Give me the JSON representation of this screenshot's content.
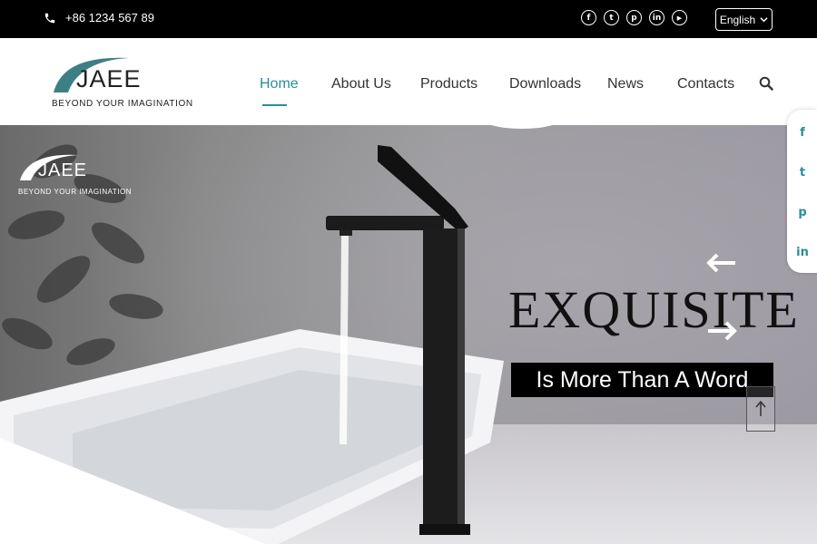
{
  "topbar": {
    "phone_icon": "phone-icon",
    "phone": "+86 1234 567 89",
    "socials": [
      {
        "name": "facebook-icon",
        "glyph": "f"
      },
      {
        "name": "twitter-icon",
        "glyph": "t"
      },
      {
        "name": "pinterest-icon",
        "glyph": "p"
      },
      {
        "name": "linkedin-icon",
        "glyph": "in"
      },
      {
        "name": "youtube-icon",
        "glyph": "▶"
      }
    ],
    "language": "English",
    "language_icon": "chevron-down-icon"
  },
  "header": {
    "logo_text": "JAEE",
    "logo_tagline": "BEYOND YOUR IMAGINATION",
    "nav": [
      {
        "label": "Home",
        "active": true
      },
      {
        "label": "About Us",
        "active": false
      },
      {
        "label": "Products",
        "active": false
      },
      {
        "label": "Downloads",
        "active": false
      },
      {
        "label": "News",
        "active": false
      },
      {
        "label": "Contacts",
        "active": false
      }
    ],
    "search_icon": "search-icon"
  },
  "hero": {
    "logo_text": "JAEE",
    "logo_tagline": "BEYOND YOUR IMAGINATION",
    "headline": "EXQUISITE",
    "tagline": "Is More Than A Word",
    "prev_icon": "arrow-left-icon",
    "next_icon": "arrow-right-icon",
    "back_to_top_icon": "arrow-up-icon"
  },
  "side_socials": [
    {
      "name": "facebook-icon",
      "glyph": "f"
    },
    {
      "name": "twitter-icon",
      "glyph": "t"
    },
    {
      "name": "pinterest-icon",
      "glyph": "p"
    },
    {
      "name": "linkedin-icon",
      "glyph": "in"
    }
  ],
  "colors": {
    "accent": "#2a8c9a",
    "topbar": "#000000"
  }
}
